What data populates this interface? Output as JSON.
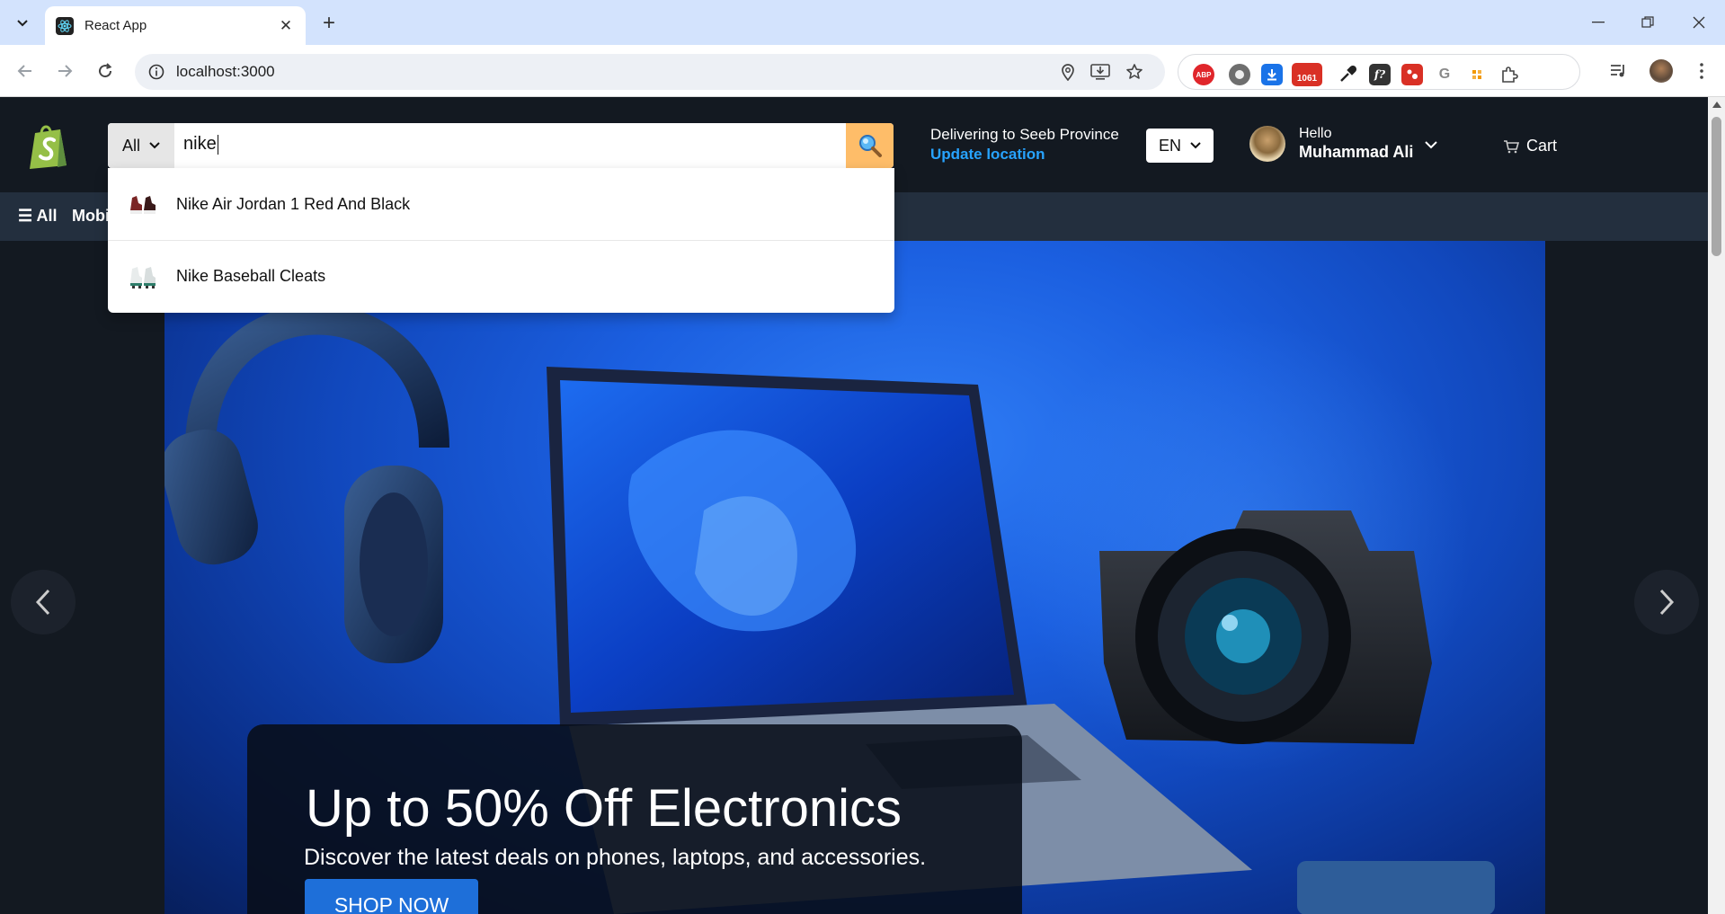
{
  "browser": {
    "tab_title": "React App",
    "url": "localhost:3000",
    "extensions": [
      {
        "name": "adblock-plus-icon",
        "label": "ABP",
        "color": "#e0262b"
      },
      {
        "name": "record-icon",
        "label": "",
        "color": "#6e6e6e"
      },
      {
        "name": "download-manager-icon",
        "label": "",
        "color": "#1a73e8"
      },
      {
        "name": "calendar-icon",
        "label": "1061",
        "color": "#d93025"
      },
      {
        "name": "eyedropper-icon",
        "label": "",
        "color": "#222222"
      },
      {
        "name": "font-icon",
        "label": "f?",
        "color": "#333333"
      },
      {
        "name": "puzzle-game-icon",
        "label": "",
        "color": "#d93025"
      },
      {
        "name": "grammarly-icon",
        "label": "G",
        "color": "#8a8a8a"
      },
      {
        "name": "grid-icon",
        "label": "",
        "color": "#f29900"
      }
    ]
  },
  "header": {
    "search_category": "All",
    "search_query": "nike",
    "deliver_label": "Delivering to Seeb Province",
    "update_location": "Update location",
    "language": "EN",
    "hello": "Hello",
    "user_name": "Muhammad Ali",
    "cart": "Cart"
  },
  "subnav": {
    "all": "All",
    "items": [
      "Mobi"
    ]
  },
  "suggestions": [
    {
      "label": "Nike Air Jordan 1 Red And Black"
    },
    {
      "label": "Nike Baseball Cleats"
    }
  ],
  "hero": {
    "title": "Up to 50% Off Electronics",
    "subtitle": "Discover the latest deals on phones, laptops, and accessories.",
    "cta": "SHOP NOW"
  },
  "colors": {
    "header_bg": "#131921",
    "subnav_bg": "#232f3e",
    "search_button": "#febd69",
    "link_blue": "#27a3ff",
    "cta_blue": "#1e6fd9"
  }
}
